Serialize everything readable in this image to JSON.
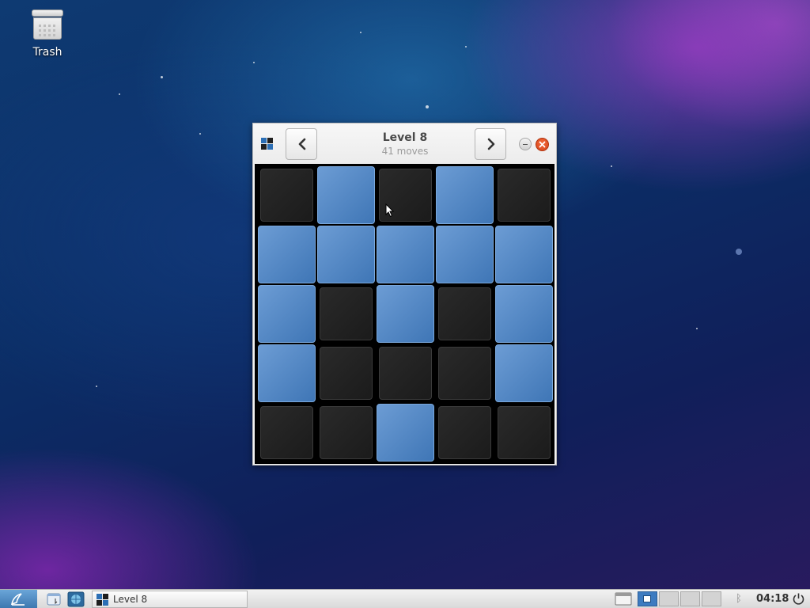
{
  "desktop": {
    "icons": [
      {
        "label": "Trash",
        "icon": "trash-icon"
      }
    ]
  },
  "window": {
    "title": "Level 8",
    "subtitle": "41 moves",
    "app_icon": "lights-off-app-icon",
    "prev_icon": "chevron-left-icon",
    "next_icon": "chevron-right-icon",
    "minimize_icon": "minimize-icon",
    "close_icon": "close-icon"
  },
  "game": {
    "rows": 5,
    "cols": 5,
    "grid": [
      [
        0,
        1,
        0,
        1,
        0
      ],
      [
        1,
        1,
        1,
        1,
        1
      ],
      [
        1,
        0,
        1,
        0,
        1
      ],
      [
        1,
        0,
        0,
        0,
        1
      ],
      [
        0,
        0,
        1,
        0,
        0
      ]
    ],
    "colors": {
      "on": "#5689c8",
      "off": "#222222",
      "background": "#000000"
    }
  },
  "taskbar": {
    "start_icon": "lxde-start-icon",
    "launchers": [
      "file-manager-icon",
      "browser-icon"
    ],
    "task_label": "Level 8",
    "workspaces": 4,
    "active_workspace": 1,
    "tray_icons": [
      "show-desktop-icon",
      "bluetooth-icon"
    ],
    "clock": "04:18",
    "power_icon": "power-icon"
  }
}
